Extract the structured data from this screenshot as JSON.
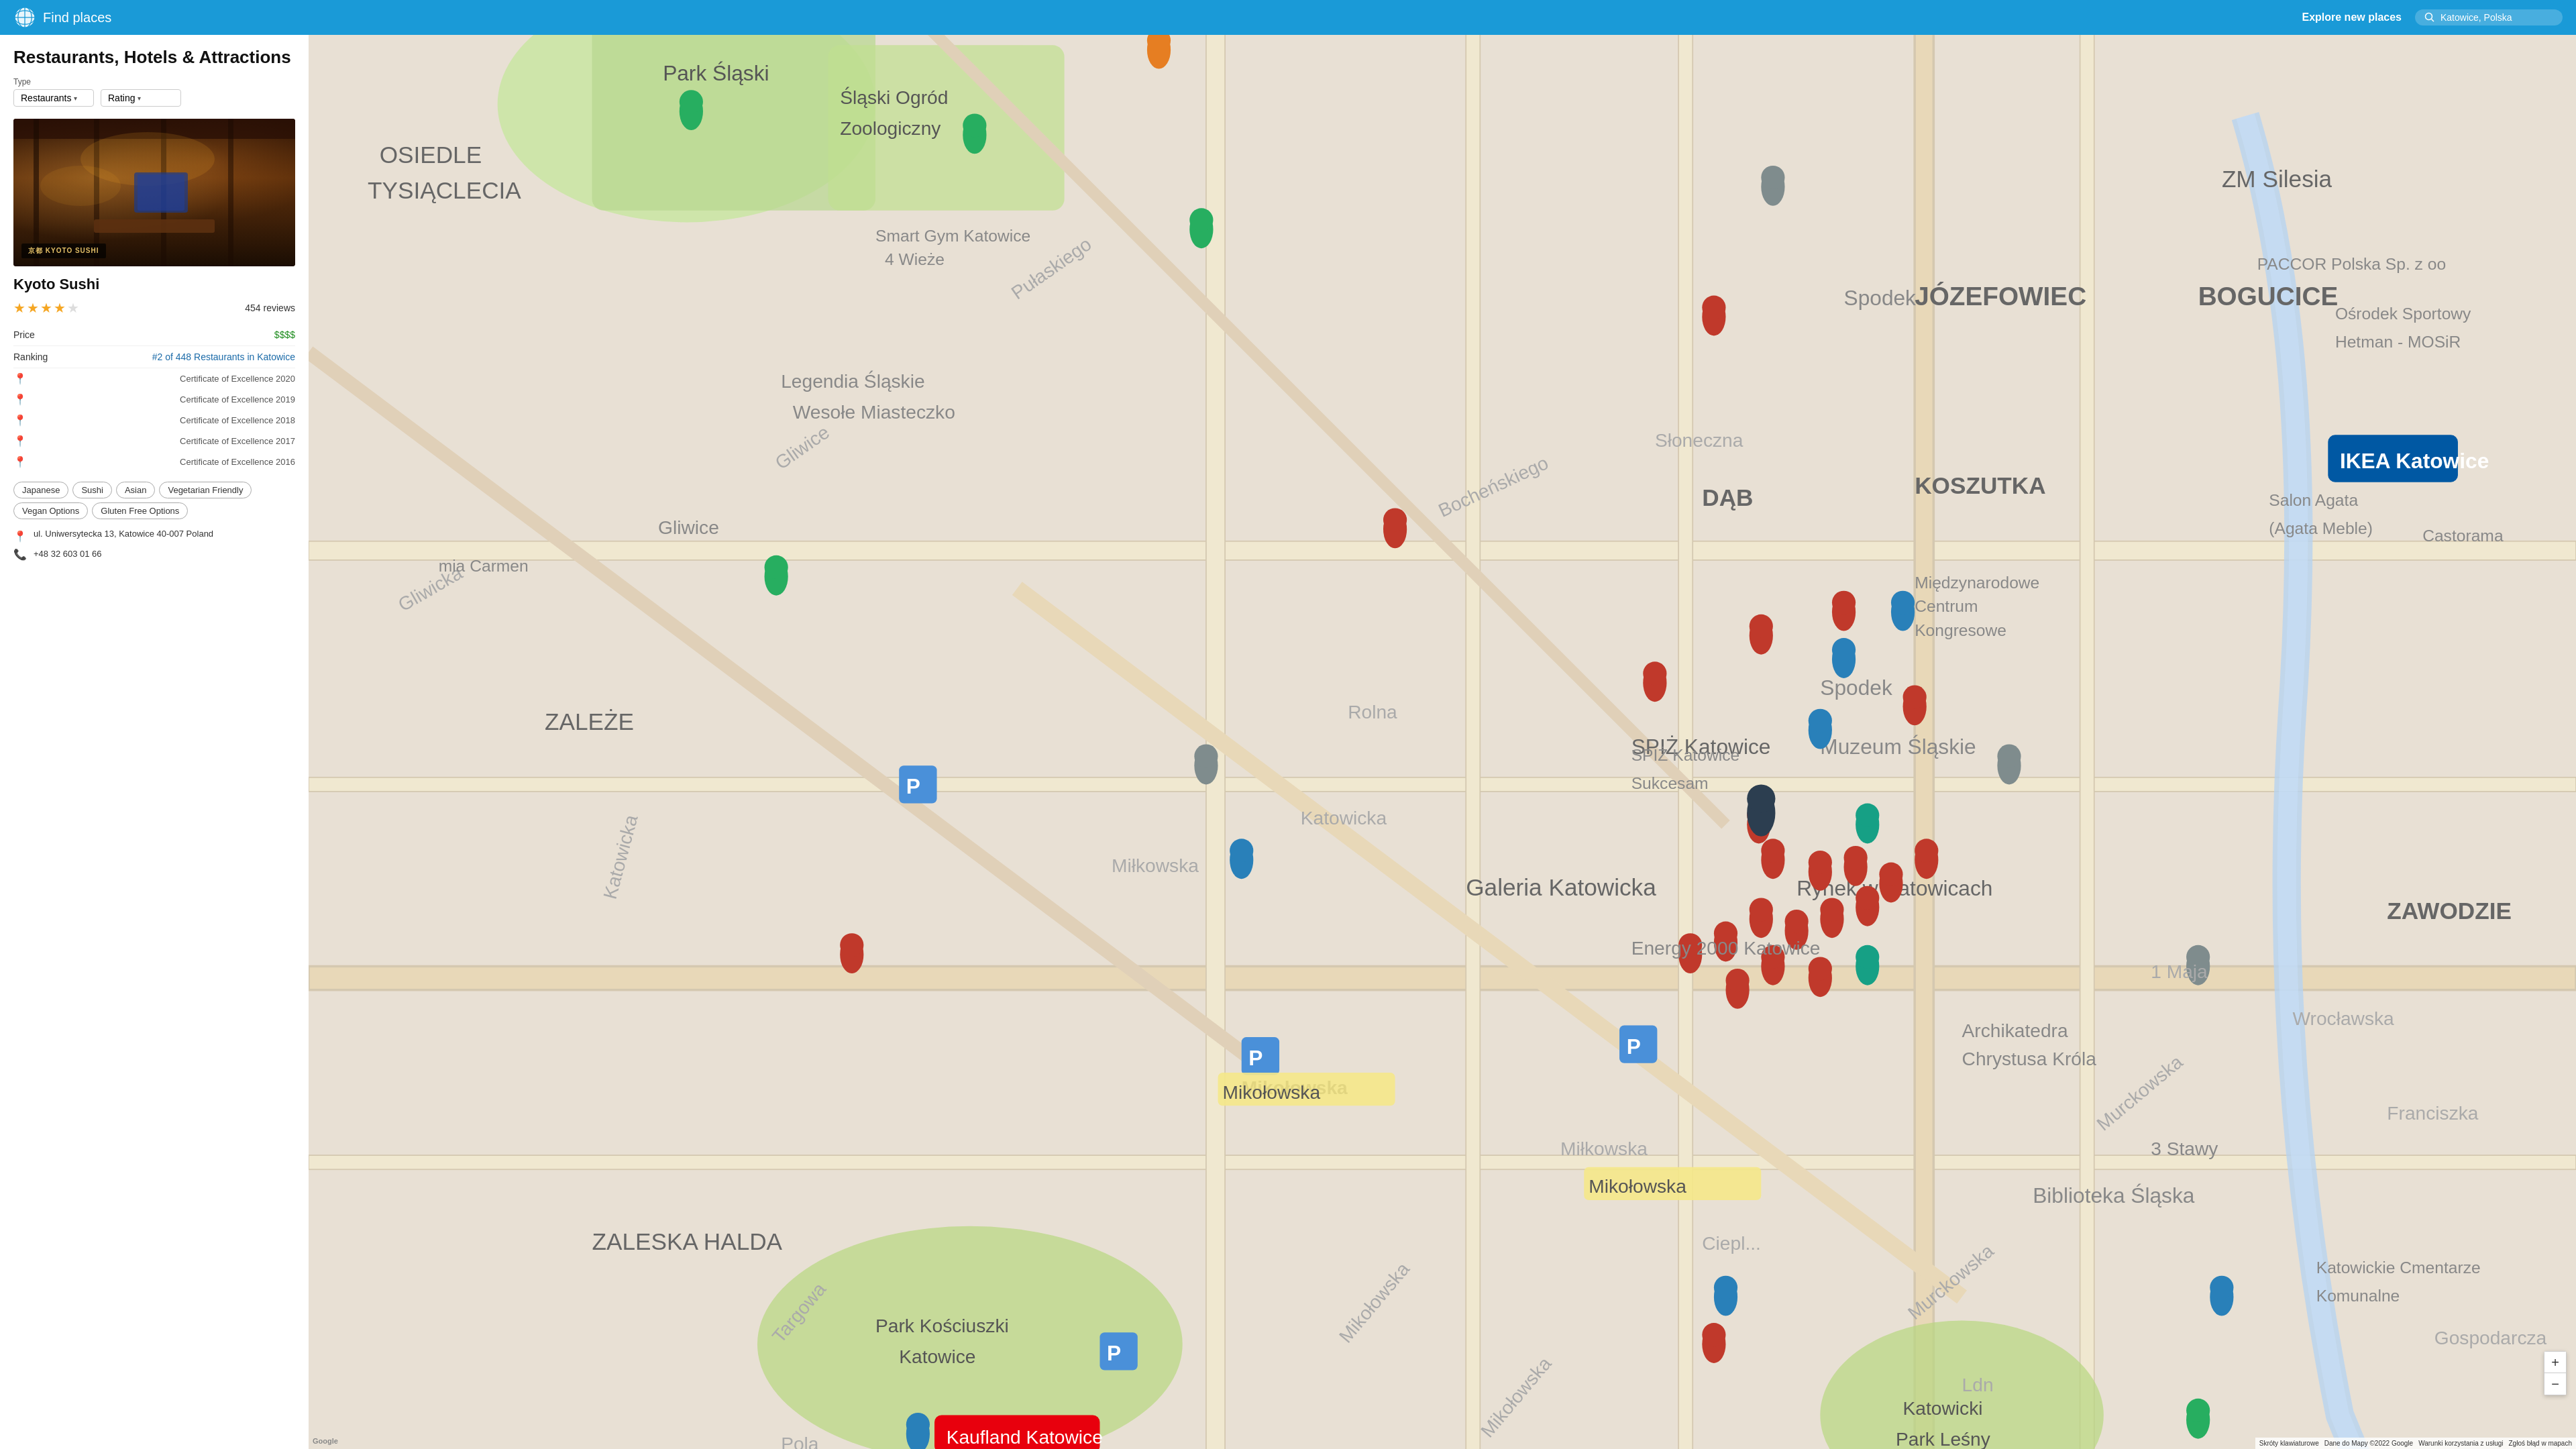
{
  "header": {
    "title": "Find places",
    "explore_label": "Explore new places",
    "search_placeholder": "Katowice, Polska"
  },
  "page": {
    "title": "Restaurants, Hotels & Attractions",
    "type_filter": {
      "label": "Type",
      "value": "Restaurants"
    },
    "rating_filter": {
      "value": "Rating"
    }
  },
  "restaurant": {
    "name": "Kyoto Sushi",
    "image_logo": "京都 KYOTO SUSHI",
    "stars": 4,
    "reviews": "454 reviews",
    "price_label": "Price",
    "price_value": "$$$$",
    "ranking_label": "Ranking",
    "ranking_value": "#2 of 448 Restaurants in Katowice",
    "certificates": [
      "Certificate of Excellence 2020",
      "Certificate of Excellence 2019",
      "Certificate of Excellence 2018",
      "Certificate of Excellence 2017",
      "Certificate of Excellence 2016"
    ],
    "tags": [
      "Japanese",
      "Sushi",
      "Asian",
      "Vegetarian Friendly",
      "Vegan Options",
      "Gluten Free Options"
    ],
    "address": "ul. Uniwersytecka 13, Katowice 40-007 Poland",
    "phone": "+48 32 603 01 66"
  },
  "map": {
    "zoom_in": "+",
    "zoom_out": "−",
    "google_text": "Google",
    "attribution": {
      "keyboard": "Skróty klawiaturowe",
      "data": "Dane do Mapy ©2022 Google",
      "terms": "Warunki korzystania z usługi",
      "report": "Zgłoś błąd w mapach"
    }
  }
}
